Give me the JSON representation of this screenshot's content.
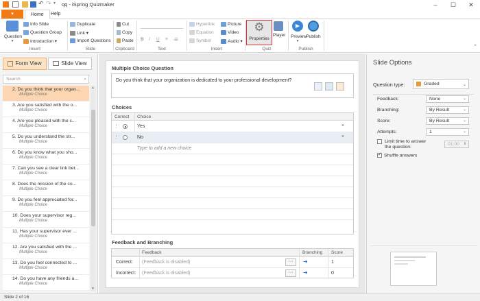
{
  "window": {
    "title": "qq - iSpring Quizmaker",
    "file_label": "▾",
    "tabs": [
      "Home",
      "Help"
    ]
  },
  "ribbon": {
    "question": "Question",
    "info_slide": "Info Slide",
    "question_group": "Question Group",
    "introduction": "Introduction",
    "duplicate": "Duplicate",
    "link": "Link",
    "import_questions": "Import Questions",
    "cut": "Cut",
    "copy": "Copy",
    "paste": "Paste",
    "hyperlink": "Hyperlink",
    "equation": "Equation",
    "symbol": "Symbol",
    "picture": "Picture",
    "video": "Video",
    "audio": "Audio",
    "properties": "Properties",
    "player": "Player",
    "preview": "Preview",
    "publish": "Publish",
    "groups": [
      "Insert",
      "Slide",
      "Clipboard",
      "Text",
      "Insert",
      "Quiz",
      "Publish"
    ]
  },
  "leftpanel": {
    "form_view": "Form View",
    "slide_view": "Slide View",
    "search_placeholder": "Search",
    "slides": [
      {
        "q": "2. Do you think that your organ...",
        "t": "Multiple Choice"
      },
      {
        "q": "3. Are you satisfied with the o...",
        "t": "Multiple Choice"
      },
      {
        "q": "4. Are you pleased with the c...",
        "t": "Multiple Choice"
      },
      {
        "q": "5. Do you understand the str...",
        "t": "Multiple Choice"
      },
      {
        "q": "6. Do you know what you sho...",
        "t": "Multiple Choice"
      },
      {
        "q": "7. Can you see a clear link bet...",
        "t": "Multiple Choice"
      },
      {
        "q": "8. Does the mission of the co...",
        "t": "Multiple Choice"
      },
      {
        "q": "9. Do you feel appreciated for...",
        "t": "Multiple Choice"
      },
      {
        "q": "10. Does your supervisor reg...",
        "t": "Multiple Choice"
      },
      {
        "q": "11. Has your supervisor ever ...",
        "t": "Multiple Choice"
      },
      {
        "q": "12. Are you satisfied with the ...",
        "t": "Multiple Choice"
      },
      {
        "q": "13. Do you feel connected to ...",
        "t": "Multiple Choice"
      },
      {
        "q": "14. Do you have any friends a...",
        "t": "Multiple Choice"
      }
    ]
  },
  "editor": {
    "mcq_title": "Multiple Choice Question",
    "question_text": "Do you think that your organization is dedicated to your professional development?",
    "choices_title": "Choices",
    "col_correct": "Correct",
    "col_choice": "Choice",
    "choice1": "Yes",
    "choice2": "No",
    "new_choice_placeholder": "Type to add a new choice",
    "remove": "×",
    "fb_title": "Feedback and Branching",
    "col_feedback": "Feedback",
    "col_branching": "Branching",
    "col_score": "Score",
    "correct_label": "Correct:",
    "incorrect_label": "Incorrect:",
    "fb_disabled": "(Feedback is disabled)",
    "dots": "···",
    "score_correct": "1",
    "score_incorrect": "0"
  },
  "options": {
    "title": "Slide Options",
    "question_type_label": "Question type:",
    "question_type_value": "Graded",
    "feedback_label": "Feedback:",
    "feedback_value": "None",
    "branching_label": "Branching:",
    "branching_value": "By Result",
    "score_label": "Score:",
    "score_value": "By Result",
    "attempts_label": "Attempts:",
    "attempts_value": "1",
    "limit_time_label": "Limit time to answer the question:",
    "time_value": "01:00",
    "shuffle_label": "Shuffle answers"
  },
  "status": {
    "text": "Slide 2 of 16"
  }
}
